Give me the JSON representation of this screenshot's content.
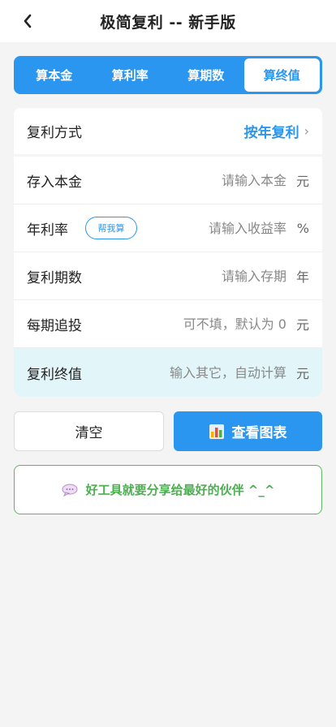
{
  "header": {
    "title": "极简复利 -- 新手版",
    "back_icon": "chevron-left-icon"
  },
  "tabs": [
    {
      "label": "算本金",
      "active": false
    },
    {
      "label": "算利率",
      "active": false
    },
    {
      "label": "算期数",
      "active": false
    },
    {
      "label": "算终值",
      "active": true
    }
  ],
  "compound_method": {
    "label": "复利方式",
    "value": "按年复利",
    "arrow": "›"
  },
  "fields": {
    "principal": {
      "label": "存入本金",
      "placeholder": "请输入本金",
      "unit": "元",
      "value": ""
    },
    "rate": {
      "label": "年利率",
      "help": "帮我算",
      "placeholder": "请输入收益率",
      "unit": "%",
      "value": ""
    },
    "periods": {
      "label": "复利期数",
      "placeholder": "请输入存期",
      "unit": "年",
      "value": ""
    },
    "additional": {
      "label": "每期追投",
      "placeholder": "可不填，默认为 0",
      "unit": "元",
      "value": ""
    },
    "final_value": {
      "label": "复利终值",
      "placeholder": "输入其它，自动计算",
      "unit": "元",
      "value": ""
    }
  },
  "buttons": {
    "clear": "清空",
    "chart": "查看图表",
    "chart_icon": "bar-chart-icon"
  },
  "share": {
    "text": "好工具就要分享给最好的伙伴 ^_^",
    "icon": "speech-bubble-icon"
  },
  "colors": {
    "accent": "#2a96f0",
    "share_green": "#4caf50",
    "highlight_row": "#e2f6f9",
    "background": "#f4f4f4"
  }
}
